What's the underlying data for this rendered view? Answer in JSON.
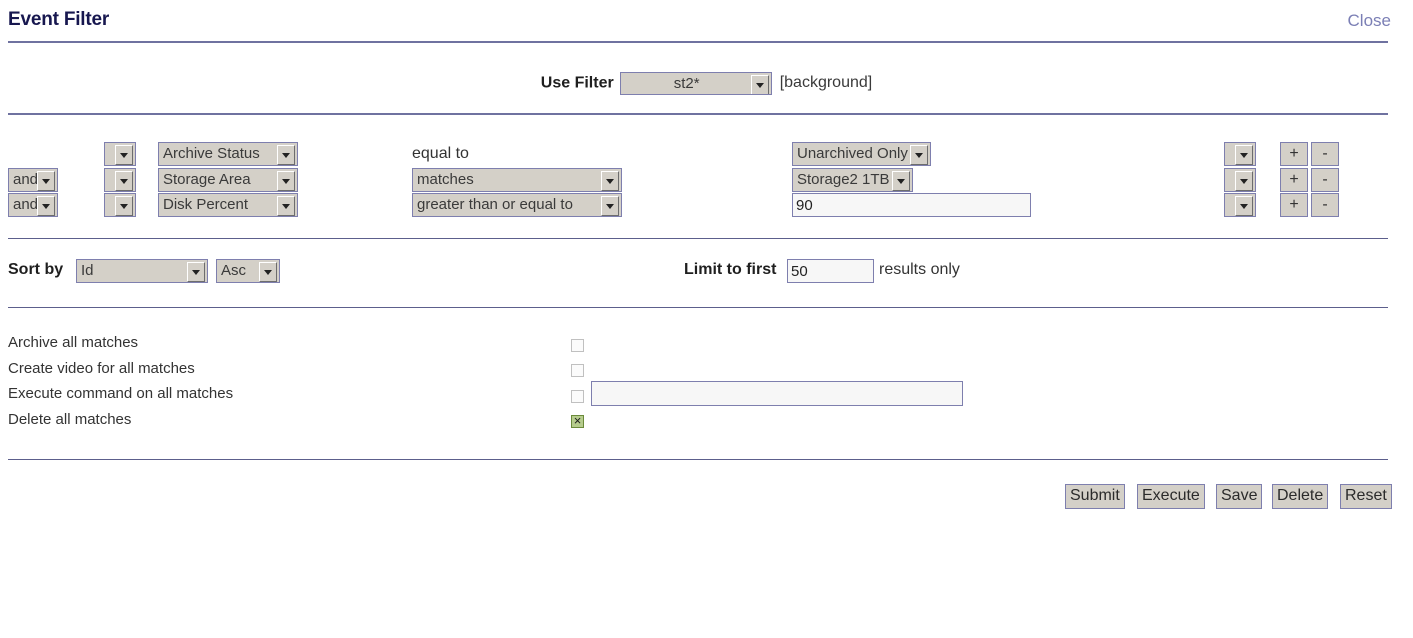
{
  "header": {
    "title": "Event Filter",
    "close_label": "Close"
  },
  "use_filter": {
    "label": "Use Filter",
    "selected": "st2*",
    "background_note": "[background]"
  },
  "conditions": {
    "rows": [
      {
        "conjunction": "",
        "conjunction_visible": false,
        "open_paren": "",
        "field": "Archive Status",
        "operator": "equal to",
        "operator_is_select": false,
        "value": "Unarchived Only",
        "value_is_select": true,
        "close_paren": "",
        "add_label": "+",
        "remove_label": "-"
      },
      {
        "conjunction": "and",
        "conjunction_visible": true,
        "open_paren": "",
        "field": "Storage Area",
        "operator": "matches",
        "operator_is_select": true,
        "value": "Storage2 1TB",
        "value_is_select": true,
        "close_paren": "",
        "add_label": "+",
        "remove_label": "-"
      },
      {
        "conjunction": "and",
        "conjunction_visible": true,
        "open_paren": "",
        "field": "Disk Percent",
        "operator": "greater than or equal to",
        "operator_is_select": true,
        "value": "90",
        "value_is_select": false,
        "close_paren": "",
        "add_label": "+",
        "remove_label": "-"
      }
    ]
  },
  "sort": {
    "sort_by_label": "Sort by",
    "sort_field": "Id",
    "sort_direction": "Asc",
    "limit_label": "Limit to first",
    "limit_value": "50",
    "results_label": "results only"
  },
  "actions": {
    "rows": [
      {
        "label": "Archive all matches",
        "checked": false,
        "has_input": false,
        "input_value": ""
      },
      {
        "label": "Create video for all matches",
        "checked": false,
        "has_input": false,
        "input_value": ""
      },
      {
        "label": "Execute command on all matches",
        "checked": false,
        "has_input": true,
        "input_value": ""
      },
      {
        "label": "Delete all matches",
        "checked": true,
        "has_input": false,
        "input_value": ""
      }
    ]
  },
  "footer": {
    "submit_label": "Submit",
    "execute_label": "Execute",
    "save_label": "Save",
    "delete_label": "Delete",
    "reset_label": "Reset"
  },
  "colors": {
    "title": "#17174f",
    "link": "#7b7fb5",
    "rule": "#6f72a0",
    "widget_border": "#7e7fae",
    "widget_face": "#d4d0c8",
    "checked_checkbox": "#b6cc8d"
  }
}
